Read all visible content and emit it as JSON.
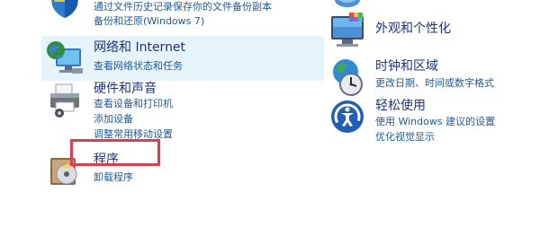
{
  "left": {
    "system_security": {
      "links": [
        "通过文件历史记录保存你的文件备份副本",
        "备份和还原(Windows 7)"
      ]
    },
    "network": {
      "title": "网络和 Internet",
      "links": [
        "查看网络状态和任务"
      ]
    },
    "hardware": {
      "title": "硬件和声音",
      "links": [
        "查看设备和打印机",
        "添加设备",
        "调整常用移动设置"
      ]
    },
    "programs": {
      "title": "程序",
      "links": [
        "卸载程序"
      ]
    }
  },
  "right": {
    "appearance": {
      "title": "外观和个性化"
    },
    "clock_region": {
      "title": "时钟和区域",
      "links": [
        "更改日期、时间或数字格式"
      ]
    },
    "ease_access": {
      "title": "轻松使用",
      "links": [
        "使用 Windows 建议的设置",
        "优化视觉显示"
      ]
    }
  },
  "colors": {
    "title": "#1e3287",
    "link": "#1e5aa8",
    "hover_bg": "#e5f3fb",
    "annotation": "#e8394a"
  },
  "icons": [
    "shield-icon",
    "network-globe-icon",
    "printer-icon",
    "programs-disc-icon",
    "user-account-icon",
    "appearance-monitor-icon",
    "clock-globe-icon",
    "ease-of-access-icon"
  ]
}
